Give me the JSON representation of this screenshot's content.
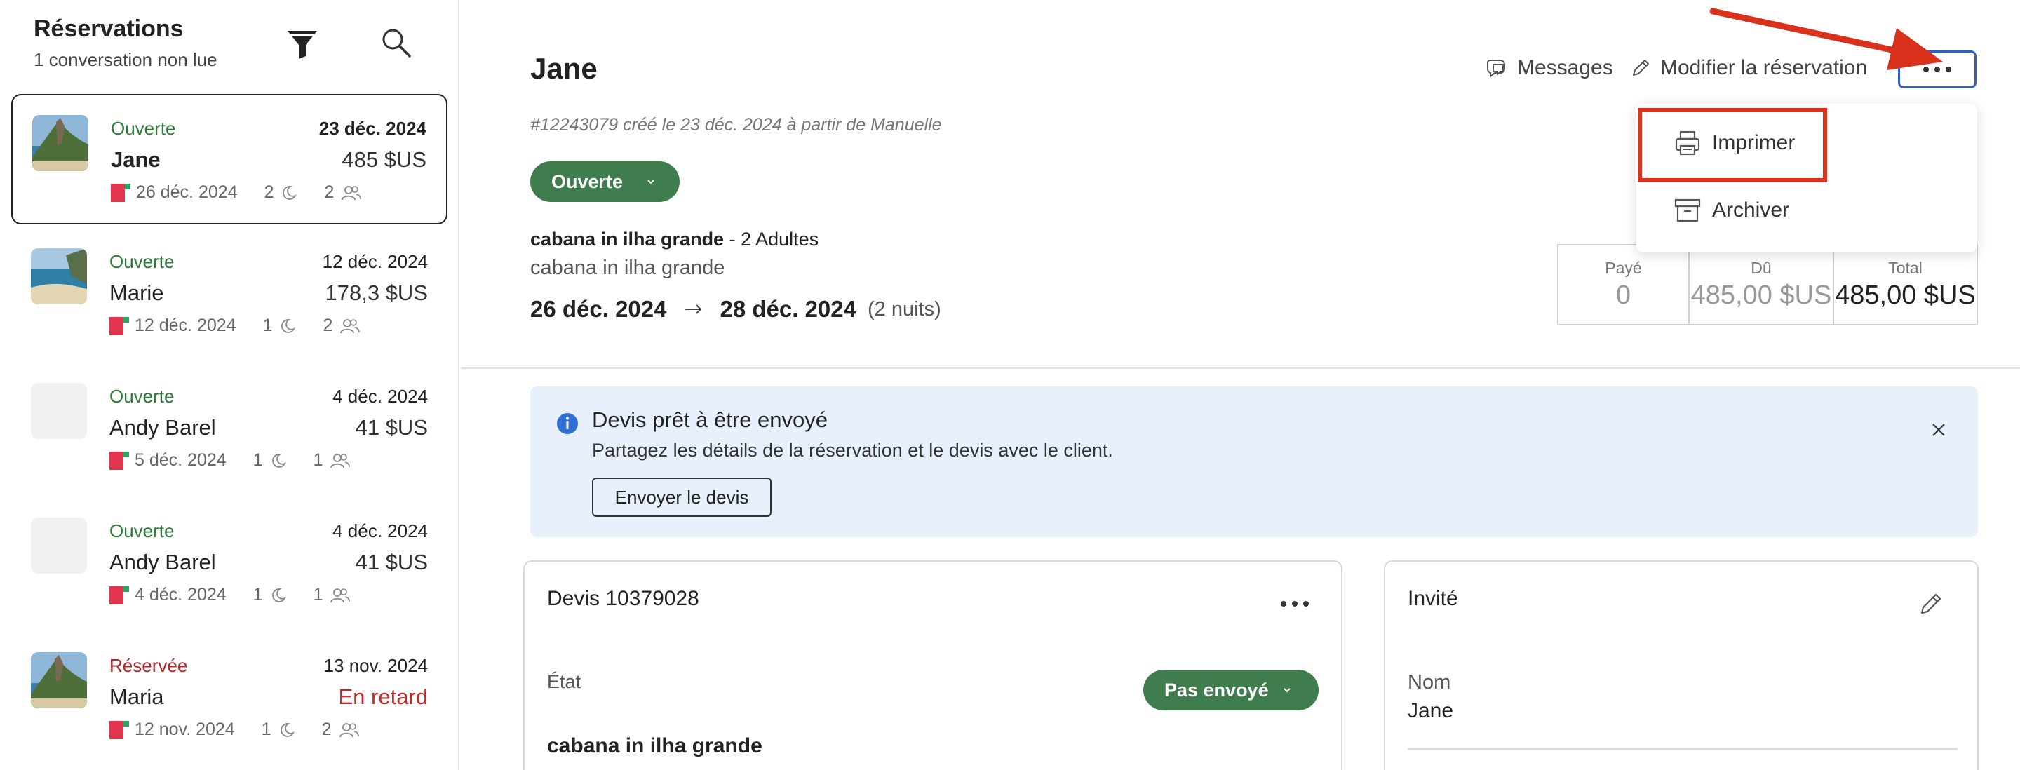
{
  "sidebar": {
    "title": "Réservations",
    "subtitle": "1 conversation non lue",
    "filter_icon": "filter-icon",
    "search_icon": "search-icon",
    "items": [
      {
        "status": "Ouverte",
        "status_color": "#2e7a3a",
        "date": "23 déc. 2024",
        "name": "Jane",
        "amount": "485 $US",
        "checkin": "26 déc. 2024",
        "nights": "2",
        "guests": "2",
        "thumb": "beach-cliff"
      },
      {
        "status": "Ouverte",
        "status_color": "#2e7a3a",
        "date": "12 déc. 2024",
        "name": "Marie",
        "amount": "178,3 $US",
        "checkin": "12 déc. 2024",
        "nights": "1",
        "guests": "2",
        "thumb": "beach-bay"
      },
      {
        "status": "Ouverte",
        "status_color": "#2e7a3a",
        "date": "4 déc. 2024",
        "name": "Andy Barel",
        "amount": "41 $US",
        "checkin": "5 déc. 2024",
        "nights": "1",
        "guests": "1",
        "thumb": "empty"
      },
      {
        "status": "Ouverte",
        "status_color": "#2e7a3a",
        "date": "4 déc. 2024",
        "name": "Andy Barel",
        "amount": "41 $US",
        "checkin": "4 déc. 2024",
        "nights": "1",
        "guests": "1",
        "thumb": "empty"
      },
      {
        "status": "Réservée",
        "status_color": "#b3262b",
        "date": "13 nov. 2024",
        "name": "Maria",
        "amount": "En retard",
        "checkin": "12 nov. 2024",
        "nights": "1",
        "guests": "2",
        "thumb": "beach-cliff"
      }
    ]
  },
  "reservation": {
    "guest_name": "Jane",
    "created_line": "#12243079 créé le 23 déc. 2024 à partir de Manuelle",
    "status": "Ouverte",
    "listing_bold": "cabana in ilha grande",
    "listing_guests": " - 2 Adultes",
    "listing_sub": "cabana in ilha grande",
    "checkin": "26 déc. 2024",
    "checkout": "28 déc. 2024",
    "nights": "(2 nuits)"
  },
  "header_actions": {
    "messages": "Messages",
    "edit": "Modifier la réservation"
  },
  "menu": {
    "print": "Imprimer",
    "archive": "Archiver"
  },
  "totals": {
    "paid_label": "Payé",
    "paid": "0",
    "due_label": "Dû",
    "due": "485,00 $US",
    "total_label": "Total",
    "total": "485,00 $US"
  },
  "banner": {
    "title": "Devis prêt à être envoyé",
    "text": "Partagez les détails de la réservation et le devis avec le client.",
    "button": "Envoyer le devis"
  },
  "quote": {
    "title": "Devis 10379028",
    "state_label": "État",
    "state": "Pas envoyé",
    "listing": "cabana in ilha grande"
  },
  "guest": {
    "title": "Invité",
    "name_label": "Nom",
    "name": "Jane"
  },
  "colors": {
    "accent_green": "#3f7d4f",
    "highlight_red": "#d9311c",
    "focus_blue": "#2f5fbf",
    "banner_bg": "#e8f0fc"
  }
}
